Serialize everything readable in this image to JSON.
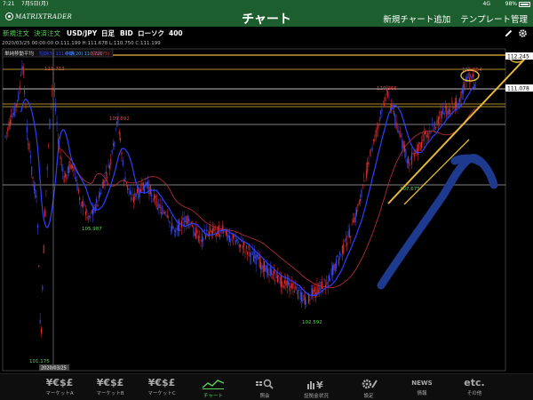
{
  "statusbar": {
    "time": "7:21",
    "date": "7月5日(月)",
    "network": "4G",
    "battery": "98%"
  },
  "navbar": {
    "logo": "MATRIXTRADER",
    "title": "チャート",
    "actions": [
      "新規チャート追加",
      "テンプレート管理"
    ]
  },
  "toolbar": {
    "new_order": "新規注文",
    "settle_order": "決済注文",
    "pair": "USD/JPY",
    "period": "日足",
    "bid": "BID",
    "chart_type": "ローソク",
    "count": "400"
  },
  "infoline": "2020/03/25 00:00:00   O:111.199 H:111.678 L:110.750 C:111.199",
  "chart": {
    "indicator_label": "単純移動平均",
    "ma_labels": [
      "短期(5) 111.078",
      "中期(20) 110.720",
      "長期(75)"
    ],
    "price_tags": [
      "112.245",
      "111.078"
    ],
    "annotations": [
      "111.713",
      "109.892",
      "105.987",
      "101.175",
      "102.592",
      "110.966",
      "111.654",
      "107.675"
    ],
    "date_tag": "2020/03/25",
    "colors": {
      "candle_up": "#e8312f",
      "candle_down": "#3b4dff",
      "ma_short": "#2f3fff",
      "ma_long": "#c0303a",
      "drawing_yellow": "#e6b93a",
      "drawing_blue": "#1e3a8f",
      "price_tag_bg": "#ffffff"
    }
  },
  "tabs": [
    {
      "icon": "¥€$£",
      "label": "マーケットA"
    },
    {
      "icon": "¥€$£",
      "label": "マーケットB"
    },
    {
      "icon": "¥€$£",
      "label": "マーケットC"
    },
    {
      "icon": "chart",
      "label": "チャート"
    },
    {
      "icon": "search",
      "label": "照会"
    },
    {
      "icon": "yen",
      "label": "証拠金状況"
    },
    {
      "icon": "gear",
      "label": "設定"
    },
    {
      "icon": "NEWS",
      "label": "情報"
    },
    {
      "icon": "etc.",
      "label": "その他"
    }
  ]
}
